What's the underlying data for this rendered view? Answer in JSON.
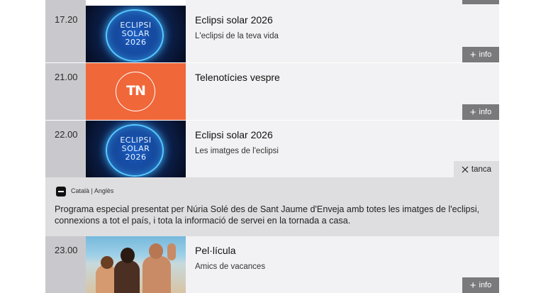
{
  "rows": [
    {
      "time": "17.20",
      "title": "Eclipsi solar 2026",
      "subtitle": "L'eclipsi de la teva vida",
      "thumb_text": [
        "ECLIPSI",
        "SOLAR",
        "2026"
      ],
      "info_label": "info"
    },
    {
      "time": "21.00",
      "title": "Telenotícies vespre",
      "subtitle": "",
      "thumb_text": [
        "TN"
      ],
      "info_label": "info"
    },
    {
      "time": "22.00",
      "title": "Eclipsi solar 2026",
      "subtitle": "Les imatges de l'eclipsi",
      "thumb_text": [
        "ECLIPSI",
        "SOLAR",
        "2026"
      ]
    },
    {
      "time": "23.00",
      "title": "Pel·lícula",
      "subtitle": "Amics de vacances",
      "info_label": "info"
    }
  ],
  "details": {
    "close_label": "tanca",
    "languages": "Català | Anglès",
    "description": "Programa especial presentat per Núria Solé des de Sant Jaume d'Enveja amb totes les imatges de l'eclipsi, connexions a tot el país, i tota la informació de servei en la tornada a casa."
  },
  "colors": {
    "time_bg": "#c9c9cd",
    "row_bg": "#f2f2f4",
    "details_bg": "#dedee0",
    "info_btn": "#7a7a7c",
    "tn_orange": "#f0673a"
  },
  "icons": {
    "info": "plus-icon",
    "close": "close-icon",
    "language": "subtitles-icon"
  }
}
